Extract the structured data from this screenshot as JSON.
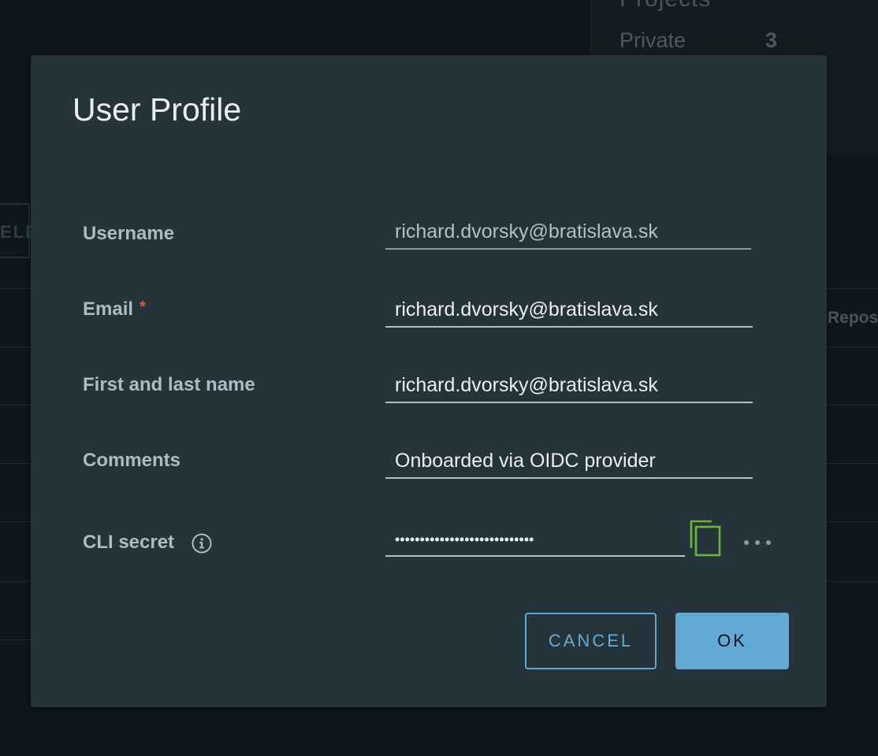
{
  "background": {
    "card_title": "Projects",
    "card_label": "Private",
    "card_value": "3",
    "button_text": "ELE",
    "column_header": "Reposito"
  },
  "modal": {
    "title": "User Profile",
    "fields": {
      "username": {
        "label": "Username",
        "value": "richard.dvorsky@bratislava.sk"
      },
      "email": {
        "label": "Email",
        "required_mark": "*",
        "value": "richard.dvorsky@bratislava.sk"
      },
      "fullname": {
        "label": "First and last name",
        "value": "richard.dvorsky@bratislava.sk"
      },
      "comments": {
        "label": "Comments",
        "value": "Onboarded via OIDC provider"
      },
      "cli_secret": {
        "label": "CLI secret",
        "value": "••••••••••••••••••••••••••••"
      }
    },
    "icons": {
      "info": "info-icon",
      "copy": "copy-icon",
      "more": "more-options-icon"
    },
    "buttons": {
      "cancel": "CANCEL",
      "ok": "OK"
    }
  },
  "colors": {
    "accent": "#62a9d5",
    "copy_icon": "#6cb53a",
    "required": "#e0543a"
  }
}
